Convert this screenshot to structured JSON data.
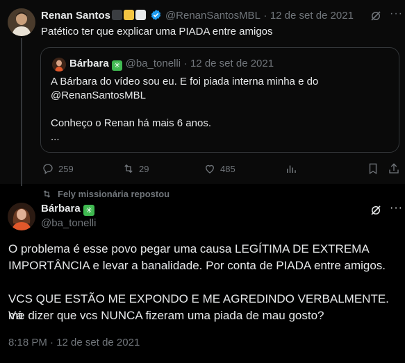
{
  "tweet1": {
    "author_name": "Renan Santos",
    "handle": "@RenanSantosMBL",
    "dot": "·",
    "date": "12 de set de 2021",
    "badge_colors": [
      "#3a3d41",
      "#f4c542",
      "#e7e9ea"
    ],
    "verified_color": "#1d9bf0",
    "text": "Patético ter que explicar uma PIADA entre amigos",
    "quote": {
      "author_name": "Bárbara",
      "handle": "@ba_tonelli",
      "dot": "·",
      "date": "12 de set de 2021",
      "line1": "A Bárbara do vídeo sou eu. E foi piada interna minha e do",
      "line2": "@RenanSantosMBL",
      "line3": "Conheço o Renan há mais 6 anos.",
      "line4": "..."
    },
    "actions": {
      "replies": "259",
      "retweets": "29",
      "likes": "485"
    }
  },
  "repost_bar": {
    "text": "Fely missionária repostou"
  },
  "tweet2": {
    "author_name": "Bárbara",
    "handle": "@ba_tonelli",
    "para1_line1": "O problema é esse povo pegar uma causa LEGÍTIMA DE EXTREMA",
    "para1_line2": "IMPORTÂNCIA e levar a banalidade. Por conta de PIADA entre amigos.",
    "para2_line1": "VCS QUE ESTÃO ME EXPONDO E ME AGREDINDO VERBALMENTE. Vá",
    "para2_line2": "me dizer que vcs NUNCA fizeram uma piada de mau gosto?",
    "timestamp": "8:18 PM · 12 de set de 2021"
  },
  "colors": {
    "background": "#000000",
    "text": "#e7e9ea",
    "muted": "#71767b",
    "border": "#333639",
    "green_badge": "#3fb950"
  }
}
